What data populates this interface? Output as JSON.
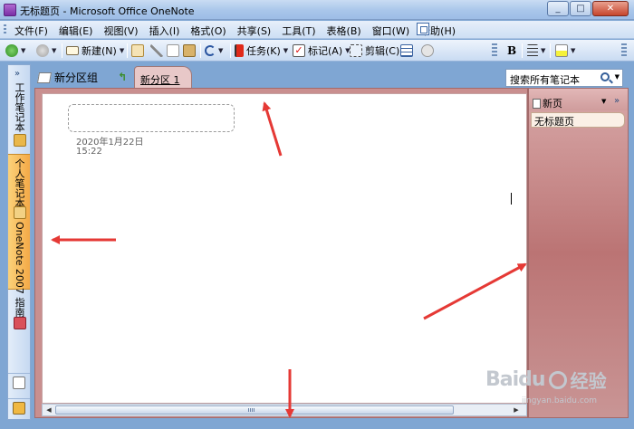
{
  "window": {
    "title": "无标题页 - Microsoft Office OneNote",
    "controls": [
      "_",
      "□",
      "✕"
    ]
  },
  "menu": {
    "items": [
      "文件(F)",
      "编辑(E)",
      "视图(V)",
      "插入(I)",
      "格式(O)",
      "共享(S)",
      "工具(T)",
      "表格(B)",
      "窗口(W)",
      "帮助(H)"
    ]
  },
  "toolbar": {
    "new_label": "新建(N)",
    "tasks_label": "任务(K)",
    "tags_label": "标记(A)",
    "clip_label": "剪辑(C)",
    "bold_label": "B"
  },
  "navpane": {
    "sections": [
      "工作笔记本",
      "个人笔记本",
      "OneNote 2007 指南"
    ],
    "chevron": "»"
  },
  "tabs": {
    "section_group": "新分区组",
    "active_section": "新分区 1",
    "search_placeholder": "搜索所有笔记本"
  },
  "page": {
    "date": "2020年1月22日",
    "time": "15:22"
  },
  "pagetabs": {
    "new_page_label": "新页",
    "pages": [
      "无标题页"
    ],
    "chevron": "»"
  },
  "watermark": {
    "brand": "Baidu",
    "sub": "经验",
    "url": "jingyan.baidu.com"
  },
  "colors": {
    "section_color": "#c98f8f",
    "annotation_arrow": "#e53935",
    "selected_notebook": "#f4a947"
  }
}
